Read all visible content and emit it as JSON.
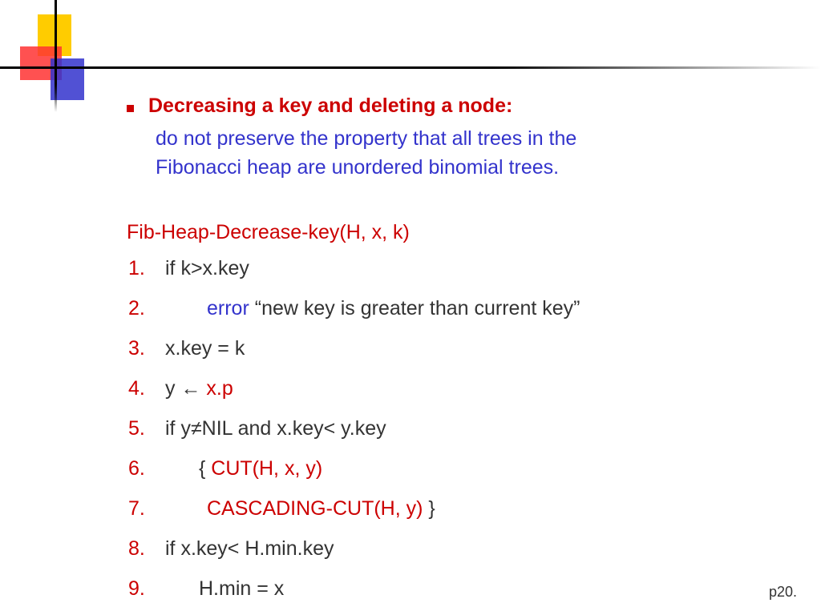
{
  "heading": "Decreasing a key and deleting a node:",
  "subtext_line1": "do not preserve the property that all trees in the",
  "subtext_line2": "Fibonacci heap are unordered binomial trees.",
  "fn_title": "Fib-Heap-Decrease-key(H, x, k)",
  "lines": {
    "n1": "1.",
    "c1": "if k>x.key",
    "n2": "2.",
    "c2a": "error",
    "c2b": " “new key is greater than current key”",
    "n3": "3.",
    "c3": "x.key = k",
    "n4": "4.",
    "c4a": "y ← ",
    "c4b": "x.p",
    "n5": "5.",
    "c5": "if y≠NIL and x.key< y.key",
    "n6": "6.",
    "c6a": "{ ",
    "c6b": "CUT(H, x, y)",
    "n7": "7.",
    "c7a": "CASCADING-CUT(H, y)",
    "c7b": " }",
    "n8": "8.",
    "c8": " if x.key< H.min.key",
    "n9": "9.",
    "c9": "H.min = x"
  },
  "page": "p20."
}
